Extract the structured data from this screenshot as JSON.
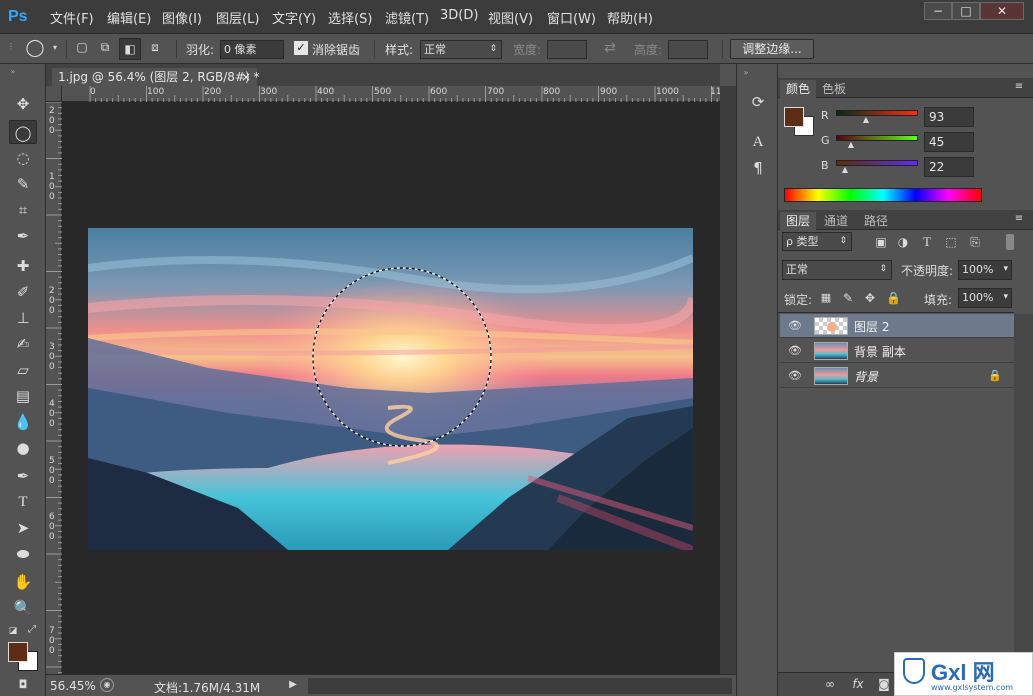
{
  "app": {
    "logo": "Ps",
    "menu": [
      "文件(F)",
      "编辑(E)",
      "图像(I)",
      "图层(L)",
      "文字(Y)",
      "选择(S)",
      "滤镜(T)",
      "3D(D)",
      "视图(V)",
      "窗口(W)",
      "帮助(H)"
    ],
    "window_buttons": [
      "−",
      "□",
      "✕"
    ]
  },
  "options": {
    "feather_label": "羽化:",
    "feather_value": "0 像素",
    "antialias_label": "消除锯齿",
    "style_label": "样式:",
    "style_value": "正常",
    "width_label": "宽度:",
    "height_label": "高度:",
    "refine_button": "调整边缘..."
  },
  "document": {
    "tab_title": "1.jpg @ 56.4% (图层 2, RGB/8#) *",
    "tab_close": "×",
    "ruler_top": [
      "0",
      "100",
      "200",
      "300",
      "400",
      "500",
      "600",
      "700",
      "800",
      "900",
      "1000",
      "11"
    ],
    "ruler_left": [
      "2\n0\n0",
      "1\n0\n0",
      "1\n5\n0",
      "2\n0\n0",
      "3\n0\n0",
      "4\n0\n0",
      "5\n0\n0",
      "6\n0\n0",
      "7\n0\n0"
    ]
  },
  "status": {
    "zoom": "56.45%",
    "doc_info": "文档:1.76M/4.31M"
  },
  "color_panel": {
    "tabs": [
      "颜色",
      "色板"
    ],
    "r_label": "R",
    "g_label": "G",
    "b_label": "B",
    "r_value": "93",
    "g_value": "45",
    "b_value": "22",
    "foreground": "#5d2d16",
    "background": "#ffffff"
  },
  "layers_panel": {
    "tabs": [
      "图层",
      "通道",
      "路径"
    ],
    "filter_label": "ρ 类型",
    "blend_mode": "正常",
    "opacity_label": "不透明度:",
    "opacity_value": "100%",
    "lock_label": "锁定:",
    "fill_label": "填充:",
    "fill_value": "100%",
    "layers": [
      {
        "name": "图层 2",
        "selected": true
      },
      {
        "name": "背景 副本",
        "selected": false
      },
      {
        "name": "背景",
        "selected": false
      }
    ]
  },
  "watermark": {
    "brand": "Gxl 网",
    "url": "www.gxlsystem.com"
  }
}
